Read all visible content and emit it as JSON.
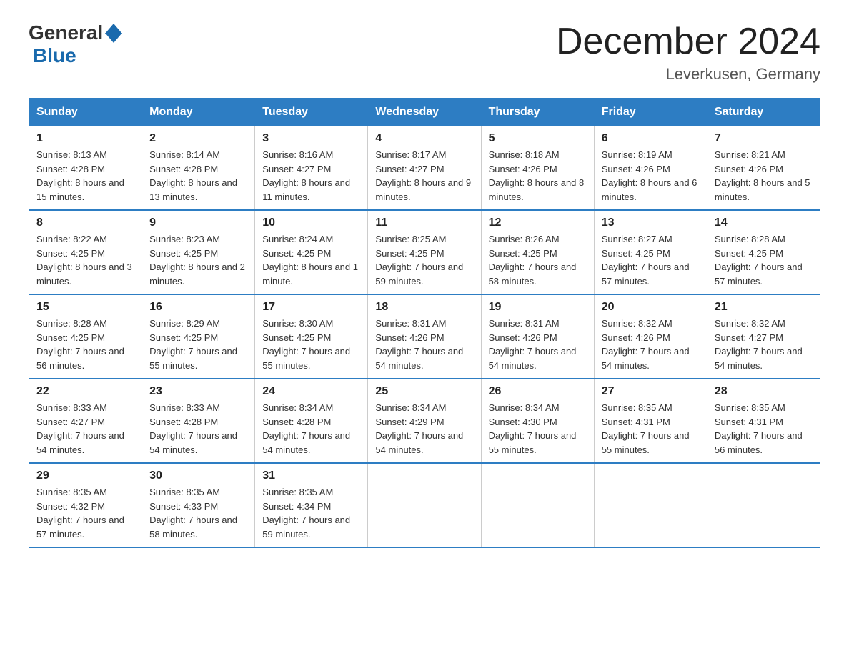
{
  "header": {
    "logo_general": "General",
    "logo_blue": "Blue",
    "title": "December 2024",
    "location": "Leverkusen, Germany"
  },
  "days_of_week": [
    "Sunday",
    "Monday",
    "Tuesday",
    "Wednesday",
    "Thursday",
    "Friday",
    "Saturday"
  ],
  "weeks": [
    [
      {
        "day": "1",
        "sunrise": "8:13 AM",
        "sunset": "4:28 PM",
        "daylight": "8 hours and 15 minutes."
      },
      {
        "day": "2",
        "sunrise": "8:14 AM",
        "sunset": "4:28 PM",
        "daylight": "8 hours and 13 minutes."
      },
      {
        "day": "3",
        "sunrise": "8:16 AM",
        "sunset": "4:27 PM",
        "daylight": "8 hours and 11 minutes."
      },
      {
        "day": "4",
        "sunrise": "8:17 AM",
        "sunset": "4:27 PM",
        "daylight": "8 hours and 9 minutes."
      },
      {
        "day": "5",
        "sunrise": "8:18 AM",
        "sunset": "4:26 PM",
        "daylight": "8 hours and 8 minutes."
      },
      {
        "day": "6",
        "sunrise": "8:19 AM",
        "sunset": "4:26 PM",
        "daylight": "8 hours and 6 minutes."
      },
      {
        "day": "7",
        "sunrise": "8:21 AM",
        "sunset": "4:26 PM",
        "daylight": "8 hours and 5 minutes."
      }
    ],
    [
      {
        "day": "8",
        "sunrise": "8:22 AM",
        "sunset": "4:25 PM",
        "daylight": "8 hours and 3 minutes."
      },
      {
        "day": "9",
        "sunrise": "8:23 AM",
        "sunset": "4:25 PM",
        "daylight": "8 hours and 2 minutes."
      },
      {
        "day": "10",
        "sunrise": "8:24 AM",
        "sunset": "4:25 PM",
        "daylight": "8 hours and 1 minute."
      },
      {
        "day": "11",
        "sunrise": "8:25 AM",
        "sunset": "4:25 PM",
        "daylight": "7 hours and 59 minutes."
      },
      {
        "day": "12",
        "sunrise": "8:26 AM",
        "sunset": "4:25 PM",
        "daylight": "7 hours and 58 minutes."
      },
      {
        "day": "13",
        "sunrise": "8:27 AM",
        "sunset": "4:25 PM",
        "daylight": "7 hours and 57 minutes."
      },
      {
        "day": "14",
        "sunrise": "8:28 AM",
        "sunset": "4:25 PM",
        "daylight": "7 hours and 57 minutes."
      }
    ],
    [
      {
        "day": "15",
        "sunrise": "8:28 AM",
        "sunset": "4:25 PM",
        "daylight": "7 hours and 56 minutes."
      },
      {
        "day": "16",
        "sunrise": "8:29 AM",
        "sunset": "4:25 PM",
        "daylight": "7 hours and 55 minutes."
      },
      {
        "day": "17",
        "sunrise": "8:30 AM",
        "sunset": "4:25 PM",
        "daylight": "7 hours and 55 minutes."
      },
      {
        "day": "18",
        "sunrise": "8:31 AM",
        "sunset": "4:26 PM",
        "daylight": "7 hours and 54 minutes."
      },
      {
        "day": "19",
        "sunrise": "8:31 AM",
        "sunset": "4:26 PM",
        "daylight": "7 hours and 54 minutes."
      },
      {
        "day": "20",
        "sunrise": "8:32 AM",
        "sunset": "4:26 PM",
        "daylight": "7 hours and 54 minutes."
      },
      {
        "day": "21",
        "sunrise": "8:32 AM",
        "sunset": "4:27 PM",
        "daylight": "7 hours and 54 minutes."
      }
    ],
    [
      {
        "day": "22",
        "sunrise": "8:33 AM",
        "sunset": "4:27 PM",
        "daylight": "7 hours and 54 minutes."
      },
      {
        "day": "23",
        "sunrise": "8:33 AM",
        "sunset": "4:28 PM",
        "daylight": "7 hours and 54 minutes."
      },
      {
        "day": "24",
        "sunrise": "8:34 AM",
        "sunset": "4:28 PM",
        "daylight": "7 hours and 54 minutes."
      },
      {
        "day": "25",
        "sunrise": "8:34 AM",
        "sunset": "4:29 PM",
        "daylight": "7 hours and 54 minutes."
      },
      {
        "day": "26",
        "sunrise": "8:34 AM",
        "sunset": "4:30 PM",
        "daylight": "7 hours and 55 minutes."
      },
      {
        "day": "27",
        "sunrise": "8:35 AM",
        "sunset": "4:31 PM",
        "daylight": "7 hours and 55 minutes."
      },
      {
        "day": "28",
        "sunrise": "8:35 AM",
        "sunset": "4:31 PM",
        "daylight": "7 hours and 56 minutes."
      }
    ],
    [
      {
        "day": "29",
        "sunrise": "8:35 AM",
        "sunset": "4:32 PM",
        "daylight": "7 hours and 57 minutes."
      },
      {
        "day": "30",
        "sunrise": "8:35 AM",
        "sunset": "4:33 PM",
        "daylight": "7 hours and 58 minutes."
      },
      {
        "day": "31",
        "sunrise": "8:35 AM",
        "sunset": "4:34 PM",
        "daylight": "7 hours and 59 minutes."
      },
      null,
      null,
      null,
      null
    ]
  ]
}
